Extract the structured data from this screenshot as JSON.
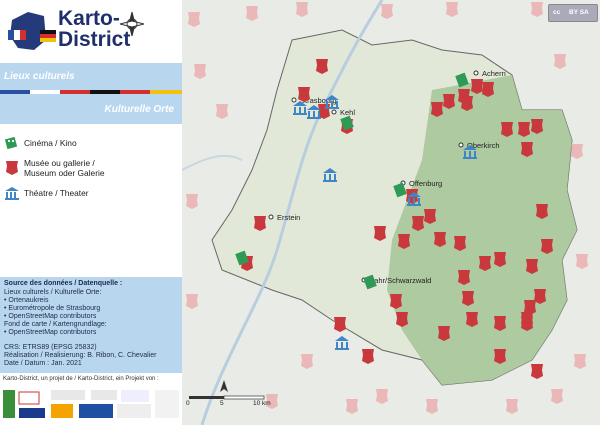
{
  "brand": {
    "title_line1": "Karto-",
    "title_line2": "District"
  },
  "bands": {
    "fr": "Lieux culturels",
    "de": "Kulturelle Orte"
  },
  "legend": [
    {
      "icon": "film-icon",
      "label": "Cinéma / Kino"
    },
    {
      "icon": "museum-icon",
      "label_line1": "Musée ou gallerie /",
      "label_line2": "Museum oder Galerie"
    },
    {
      "icon": "theater-icon",
      "label": "Théatre / Theater"
    }
  ],
  "sources": {
    "title": "Source des données / Datenquelle :",
    "lines": [
      "Lieux culturels / Kulturelle Orte:",
      "• Ortenaukreis",
      "• Eurométropole de Strasbourg",
      "• OpenStreetMap contributors",
      "Fond de carte / Kartengrundlage:",
      "• OpenStreetMap contributors",
      "",
      "CRS: ETRS89 (EPSG 25832)",
      "Réalisation / Realisierung: B. Ribon, C. Chevalier",
      "Date / Datum : Jan. 2021"
    ]
  },
  "footer": "Karto-District, un projet de / Karto-District, ein Projekt von :",
  "towns": [
    "Achern",
    "Strasbourg",
    "Kehl",
    "Oberkirch",
    "Offenburg",
    "Erstein",
    "Lahr/Schwarzwald"
  ],
  "scale": {
    "zero": "0",
    "mid": "5",
    "end": "10 km"
  },
  "colors": {
    "band": "#b9d6ef",
    "museum": "#c9383c",
    "theater": "#3e86c8",
    "cinema": "#2e9a55",
    "forest": "#a8c79a",
    "land": "#e7ece0"
  }
}
